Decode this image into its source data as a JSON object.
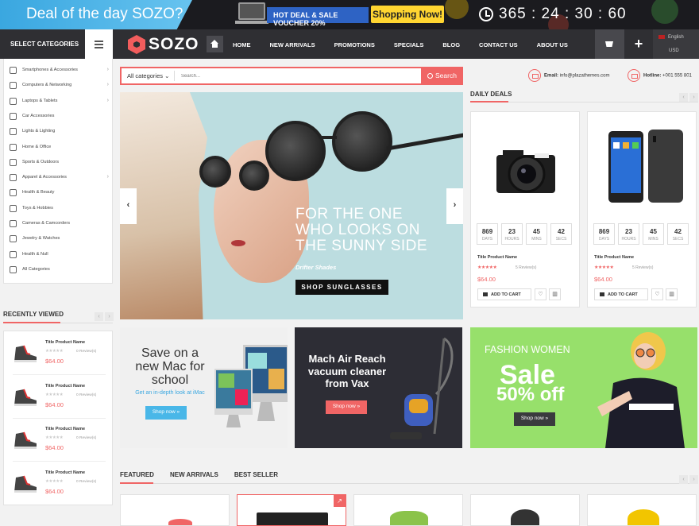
{
  "topbar": {
    "deal_text": "Deal of the day SOZO?",
    "hot_deal": "HOT DEAL & SALE VOUCHER 20%",
    "shop_now": "Shopping Now!",
    "timer": "365 : 24 : 30 : 60"
  },
  "nav": {
    "select_categories": "SELECT CATEGORIES",
    "logo": "SOZO",
    "links": [
      "HOME",
      "NEW ARRIVALS",
      "PROMOTIONS",
      "SPECIALS",
      "BLOG",
      "CONTACT US",
      "ABOUT US"
    ],
    "plus": "+",
    "language": "English",
    "currency": "USD"
  },
  "categories": [
    {
      "label": "Smartphones & Accessories",
      "arrow": true,
      "icon": "phone-icon"
    },
    {
      "label": "Computers & Networking",
      "arrow": true,
      "icon": "computer-icon"
    },
    {
      "label": "Laptops & Tablets",
      "arrow": true,
      "icon": "laptop-icon"
    },
    {
      "label": "Car Accessories",
      "arrow": false,
      "icon": "car-icon"
    },
    {
      "label": "Lights & Lighting",
      "arrow": false,
      "icon": "light-icon"
    },
    {
      "label": "Home & Office",
      "arrow": false,
      "icon": "chair-icon"
    },
    {
      "label": "Sports & Outdoors",
      "arrow": false,
      "icon": "bike-icon"
    },
    {
      "label": "Apparel & Accessories",
      "arrow": true,
      "icon": "apparel-icon"
    },
    {
      "label": "Health & Beauty",
      "arrow": false,
      "icon": "dryer-icon"
    },
    {
      "label": "Toys & Hobbies",
      "arrow": false,
      "icon": "rocket-icon"
    },
    {
      "label": "Cameras & Camcorders",
      "arrow": false,
      "icon": "camera-icon"
    },
    {
      "label": "Jewelry & Watches",
      "arrow": false,
      "icon": "diamond-icon"
    },
    {
      "label": "Health & Null",
      "arrow": false,
      "icon": "heart-icon"
    },
    {
      "label": "All Categories",
      "arrow": false,
      "icon": "grid-icon"
    }
  ],
  "search": {
    "all_categories": "All categories",
    "placeholder": "Search...",
    "button": "Search"
  },
  "contact": {
    "email_label": "Email:",
    "email": "info@plazathemes.com",
    "hotline_label": "Hotline:",
    "hotline": "+001 555 801"
  },
  "slider": {
    "headline_1": "FOR THE ONE",
    "headline_2": "WHO LOOKS ON",
    "headline_3": "THE SUNNY SIDE",
    "sub": "Drifter Shades",
    "button": "SHOP SUNGLASSES",
    "prev": "‹",
    "next": "›"
  },
  "daily_deals": {
    "title": "DAILY DEALS",
    "products": [
      {
        "title": "Title Product Name",
        "reviews": "5 Review(s)",
        "price": "$64.00",
        "add": "ADD TO CART",
        "countdown": [
          {
            "v": "869",
            "l": "DAYS"
          },
          {
            "v": "23",
            "l": "HOURS"
          },
          {
            "v": "45",
            "l": "MINS"
          },
          {
            "v": "42",
            "l": "SECS"
          }
        ]
      },
      {
        "title": "Title Product Name",
        "reviews": "5 Review(s)",
        "price": "$64.00",
        "add": "ADD TO CART",
        "countdown": [
          {
            "v": "869",
            "l": "DAYS"
          },
          {
            "v": "23",
            "l": "HOURS"
          },
          {
            "v": "45",
            "l": "MINS"
          },
          {
            "v": "42",
            "l": "SECS"
          }
        ]
      }
    ]
  },
  "recently_viewed": {
    "title": "RECENTLY VIEWED",
    "items": [
      {
        "title": "Title Product Name",
        "reviews": "0 Review(s)",
        "price": "$64.00"
      },
      {
        "title": "Title Product Name",
        "reviews": "0 Review(s)",
        "price": "$64.00"
      },
      {
        "title": "Title Product Name",
        "reviews": "0 Review(s)",
        "price": "$64.00"
      },
      {
        "title": "Title Product Name",
        "reviews": "0 Review(s)",
        "price": "$64.00"
      }
    ]
  },
  "banners": {
    "mac_title_1": "Save on a",
    "mac_title_2": "new Mac for",
    "mac_title_3": "school",
    "mac_sub": "Get an in-depth look at iMac",
    "mac_btn": "Shop now »",
    "vac_title_1": "Mach Air Reach",
    "vac_title_2": "vacuum cleaner",
    "vac_title_3": "from Vax",
    "vac_btn": "Shop now »",
    "fashion_1": "FASHION WOMEN",
    "fashion_2": "Sale",
    "fashion_3": "50% off",
    "fashion_btn": "Shop now »"
  },
  "tabs": [
    "FEATURED",
    "NEW ARRIVALS",
    "BEST SELLER"
  ],
  "colors": {
    "accent": "#f06565",
    "dark": "#2f2f33",
    "blue": "#3aa7e0",
    "green": "#97e06b"
  }
}
